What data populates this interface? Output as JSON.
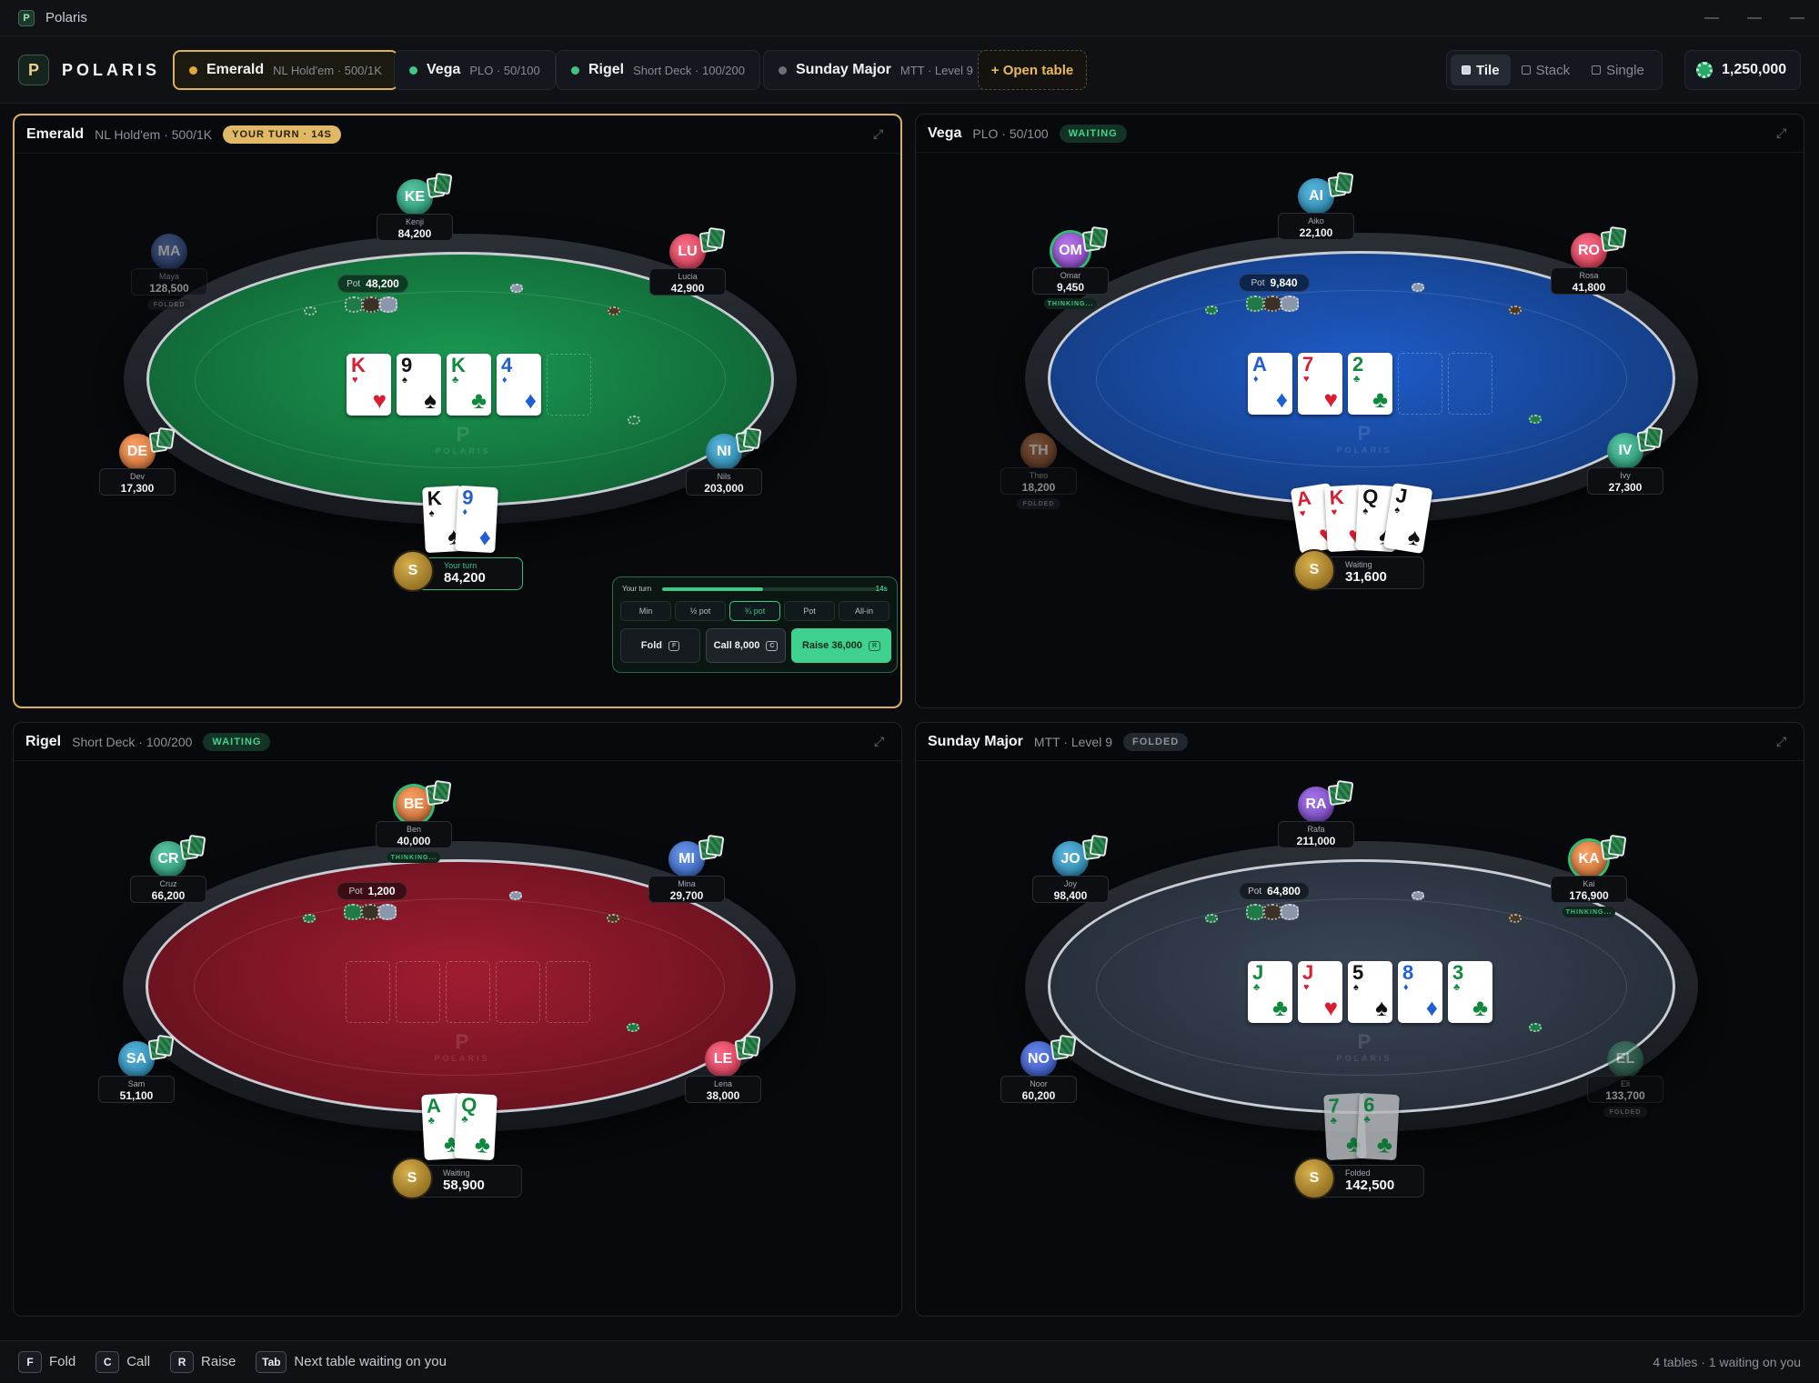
{
  "window": {
    "title": "Polaris",
    "min_icon": "minimize-icon",
    "max_icon": "maximize-icon",
    "close_icon": "close-icon"
  },
  "brand": {
    "mark": "P",
    "name": "POLARIS"
  },
  "tabs": [
    {
      "name": "Emerald",
      "meta": "NL Hold'em · 500/1K",
      "dot_color": "#e0a93a"
    },
    {
      "name": "Vega",
      "meta": "PLO · 50/100",
      "dot_color": "#3fc584"
    },
    {
      "name": "Rigel",
      "meta": "Short Deck · 100/200",
      "dot_color": "#3fc584"
    },
    {
      "name": "Sunday Major",
      "meta": "MTT · Level 9",
      "dot_color": "#6b7078"
    }
  ],
  "open_table_label": "+ Open table",
  "layouts": [
    "Tile",
    "Stack",
    "Single"
  ],
  "balance": "1,250,000",
  "colors": {
    "accent_gold": "#d9b25a",
    "accent_green": "#3fc584"
  },
  "tables": [
    {
      "name": "Emerald",
      "meta": "NL Hold'em · 500/1K",
      "badge": "YOUR TURN · 14S",
      "badge_type": "turn",
      "felt_color": "#1a9a52",
      "pot_label": "Pot",
      "pot": "48,200",
      "board": [
        {
          "r": "K",
          "s": "♥",
          "c": "red"
        },
        {
          "r": "9",
          "s": "♠",
          "c": "blk"
        },
        {
          "r": "K",
          "s": "♣",
          "c": "grn"
        },
        {
          "r": "4",
          "s": "♦",
          "c": "blu"
        },
        null
      ],
      "seats": [
        {
          "init": "KE",
          "name": "Kenji",
          "stack": "84,200",
          "color": "#1f8a6a",
          "state": ""
        },
        {
          "init": "MA",
          "name": "Maya",
          "stack": "128,500",
          "color": "#2d4a8c",
          "state": "FOLDED"
        },
        {
          "init": "LU",
          "name": "Lucia",
          "stack": "42,900",
          "color": "#c0304a",
          "state": ""
        },
        {
          "init": "DE",
          "name": "Dev",
          "stack": "17,300",
          "color": "#c0652a",
          "state": ""
        },
        {
          "init": "NI",
          "name": "Nils",
          "stack": "203,000",
          "color": "#1e7aa0",
          "state": ""
        }
      ],
      "hero": {
        "init": "S",
        "label": "Your turn",
        "stack": "84,200",
        "cards": [
          {
            "r": "K",
            "s": "♠",
            "c": "blk"
          },
          {
            "r": "9",
            "s": "♦",
            "c": "blu"
          }
        ]
      },
      "action": {
        "your_turn": "Your turn",
        "timer": "14s",
        "timer_fraction": 0.47,
        "sizes": [
          "Min",
          "½ pot",
          "¾ pot",
          "Pot",
          "All-in"
        ],
        "fold": "Fold",
        "fold_key": "F",
        "call": "Call 8,000",
        "call_key": "C",
        "raise": "Raise 36,000",
        "raise_key": "R"
      }
    },
    {
      "name": "Vega",
      "meta": "PLO · 50/100",
      "badge": "WAITING",
      "badge_type": "wait",
      "felt_color": "#1e5cc8",
      "pot_label": "Pot",
      "pot": "9,840",
      "board": [
        {
          "r": "A",
          "s": "♦",
          "c": "blu"
        },
        {
          "r": "7",
          "s": "♥",
          "c": "red"
        },
        {
          "r": "2",
          "s": "♣",
          "c": "grn"
        },
        null,
        null
      ],
      "seats": [
        {
          "init": "AI",
          "name": "Aiko",
          "stack": "22,100",
          "color": "#1e7aa0",
          "state": ""
        },
        {
          "init": "OM",
          "name": "Omar",
          "stack": "9,450",
          "color": "#7a3ab0",
          "state": "THINKING..."
        },
        {
          "init": "RO",
          "name": "Rosa",
          "stack": "41,800",
          "color": "#c0304a",
          "state": ""
        },
        {
          "init": "TH",
          "name": "Theo",
          "stack": "18,200",
          "color": "#8a4a20",
          "state": "FOLDED"
        },
        {
          "init": "IV",
          "name": "Ivy",
          "stack": "27,300",
          "color": "#1f8a6a",
          "state": ""
        }
      ],
      "hero": {
        "init": "S",
        "label": "Waiting",
        "stack": "31,600",
        "cards": [
          {
            "r": "A",
            "s": "♥",
            "c": "red"
          },
          {
            "r": "K",
            "s": "♥",
            "c": "red"
          },
          {
            "r": "Q",
            "s": "♠",
            "c": "blk"
          },
          {
            "r": "J",
            "s": "♠",
            "c": "blk"
          }
        ]
      }
    },
    {
      "name": "Rigel",
      "meta": "Short Deck · 100/200",
      "badge": "WAITING",
      "badge_type": "wait",
      "felt_color": "#a01c30",
      "pot_label": "Pot",
      "pot": "1,200",
      "board": [
        null,
        null,
        null,
        null,
        null
      ],
      "seats": [
        {
          "init": "BE",
          "name": "Ben",
          "stack": "40,000",
          "color": "#c0652a",
          "state": "THINKING..."
        },
        {
          "init": "CR",
          "name": "Cruz",
          "stack": "66,200",
          "color": "#1f8a6a",
          "state": ""
        },
        {
          "init": "MI",
          "name": "Mina",
          "stack": "29,700",
          "color": "#2d5ab0",
          "state": ""
        },
        {
          "init": "SA",
          "name": "Sam",
          "stack": "51,100",
          "color": "#1e7aa0",
          "state": ""
        },
        {
          "init": "LE",
          "name": "Lena",
          "stack": "38,000",
          "color": "#c0304a",
          "state": ""
        }
      ],
      "hero": {
        "init": "S",
        "label": "Waiting",
        "stack": "58,900",
        "cards": [
          {
            "r": "A",
            "s": "♣",
            "c": "grn"
          },
          {
            "r": "Q",
            "s": "♣",
            "c": "grn"
          }
        ]
      }
    },
    {
      "name": "Sunday Major",
      "meta": "MTT · Level 9",
      "badge": "FOLDED",
      "badge_type": "fold",
      "felt_color": "#3a4658",
      "pot_label": "Pot",
      "pot": "64,800",
      "board": [
        {
          "r": "J",
          "s": "♣",
          "c": "grn"
        },
        {
          "r": "J",
          "s": "♥",
          "c": "red"
        },
        {
          "r": "5",
          "s": "♠",
          "c": "blk"
        },
        {
          "r": "8",
          "s": "♦",
          "c": "blu"
        },
        {
          "r": "3",
          "s": "♣",
          "c": "grn"
        }
      ],
      "seats": [
        {
          "init": "RA",
          "name": "Rafa",
          "stack": "211,000",
          "color": "#6a3ab0",
          "state": ""
        },
        {
          "init": "JO",
          "name": "Joy",
          "stack": "98,400",
          "color": "#1e7aa0",
          "state": ""
        },
        {
          "init": "KA",
          "name": "Kai",
          "stack": "176,900",
          "color": "#c0652a",
          "state": "THINKING..."
        },
        {
          "init": "NO",
          "name": "Noor",
          "stack": "60,200",
          "color": "#2d4ab0",
          "state": ""
        },
        {
          "init": "EL",
          "name": "Eli",
          "stack": "133,700",
          "color": "#1f6a4a",
          "state": "FOLDED"
        }
      ],
      "hero": {
        "init": "S",
        "label": "Folded",
        "stack": "142,500",
        "cards": [
          {
            "r": "7",
            "s": "♣",
            "c": "grn"
          },
          {
            "r": "6",
            "s": "♣",
            "c": "grn"
          }
        ]
      }
    }
  ],
  "shortcuts": [
    {
      "key": "F",
      "label": "Fold"
    },
    {
      "key": "C",
      "label": "Call"
    },
    {
      "key": "R",
      "label": "Raise"
    },
    {
      "key": "Tab",
      "label": "Next table waiting on you"
    }
  ],
  "summary": "4 tables · 1 waiting on you"
}
